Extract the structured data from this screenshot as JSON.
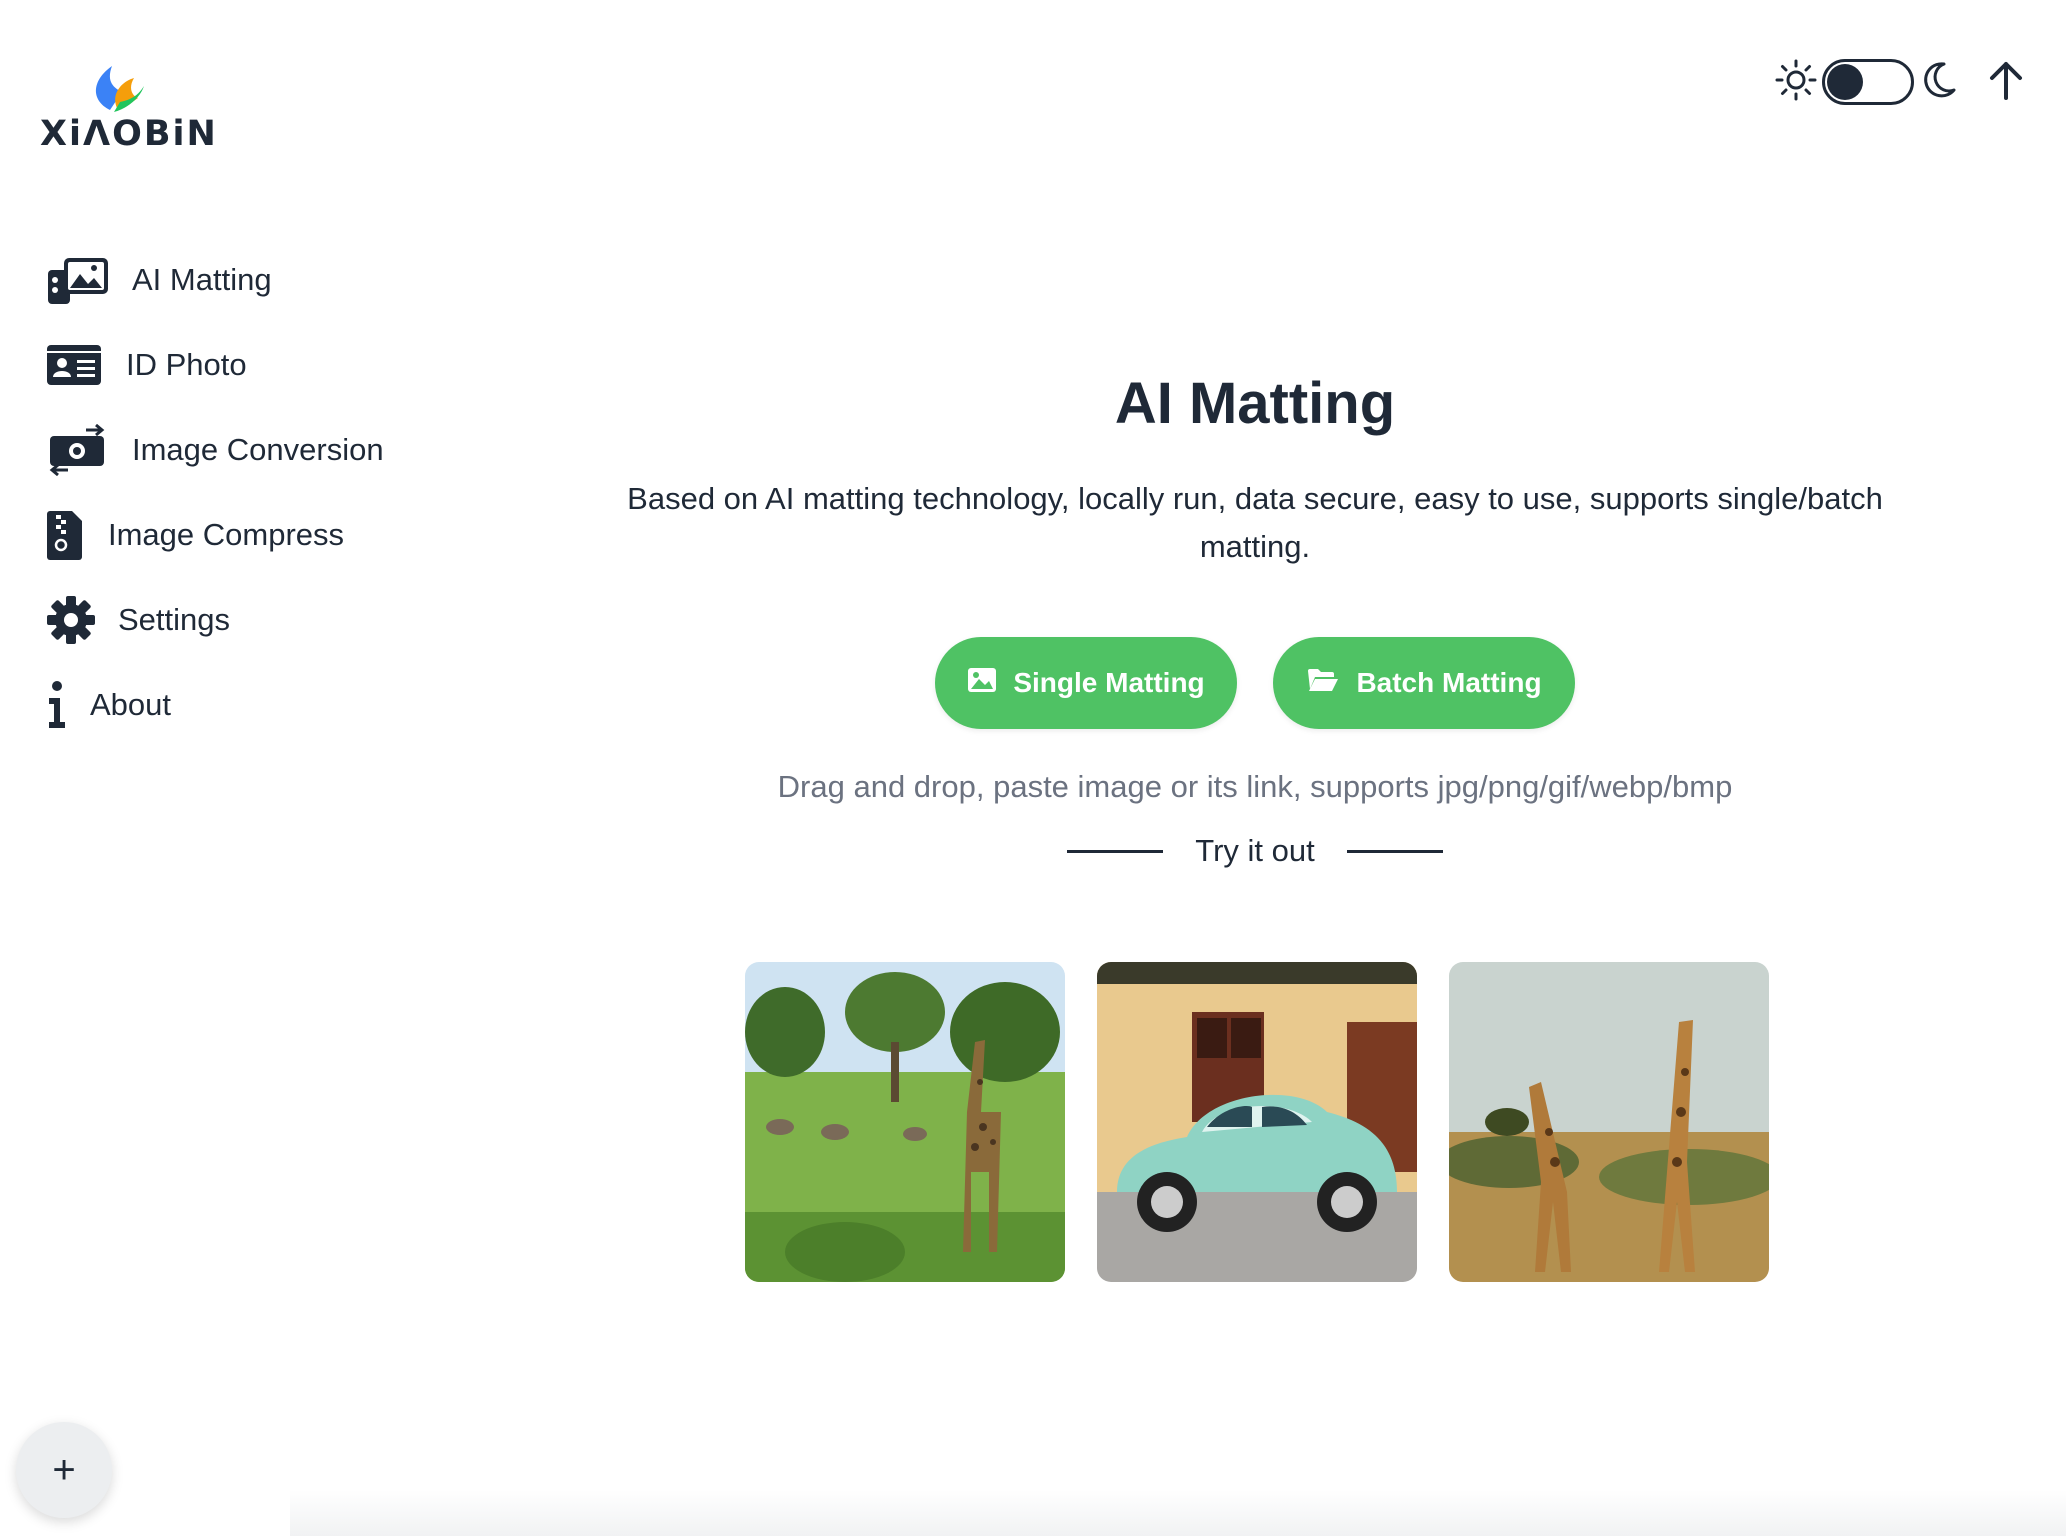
{
  "logo": {
    "text": "XiΛOBiN",
    "icon": "flame-logo"
  },
  "topbar": {
    "theme_light_icon": "sun-icon",
    "theme_dark_icon": "moon-icon",
    "scroll_top_icon": "arrow-up-icon"
  },
  "sidebar": {
    "items": [
      {
        "label": "AI Matting",
        "icon": "photos-icon"
      },
      {
        "label": "ID Photo",
        "icon": "id-card-icon"
      },
      {
        "label": "Image Conversion",
        "icon": "convert-icon"
      },
      {
        "label": "Image Compress",
        "icon": "zip-file-icon"
      },
      {
        "label": "Settings",
        "icon": "gear-icon"
      },
      {
        "label": "About",
        "icon": "info-icon"
      }
    ]
  },
  "main": {
    "title": "AI Matting",
    "description": "Based on AI matting technology, locally run, data secure, easy to use, supports single/batch matting.",
    "single_button": "Single Matting",
    "batch_button": "Batch Matting",
    "hint": "Drag and drop, paste image or its link, supports jpg/png/gif/webp/bmp",
    "try_label": "Try it out",
    "samples": [
      "giraffe in savanna",
      "vintage turquoise car",
      "two giraffes"
    ]
  },
  "fab_label": "+",
  "colors": {
    "accent": "#4fc264",
    "text": "#1f2937",
    "muted": "#6b7280"
  }
}
